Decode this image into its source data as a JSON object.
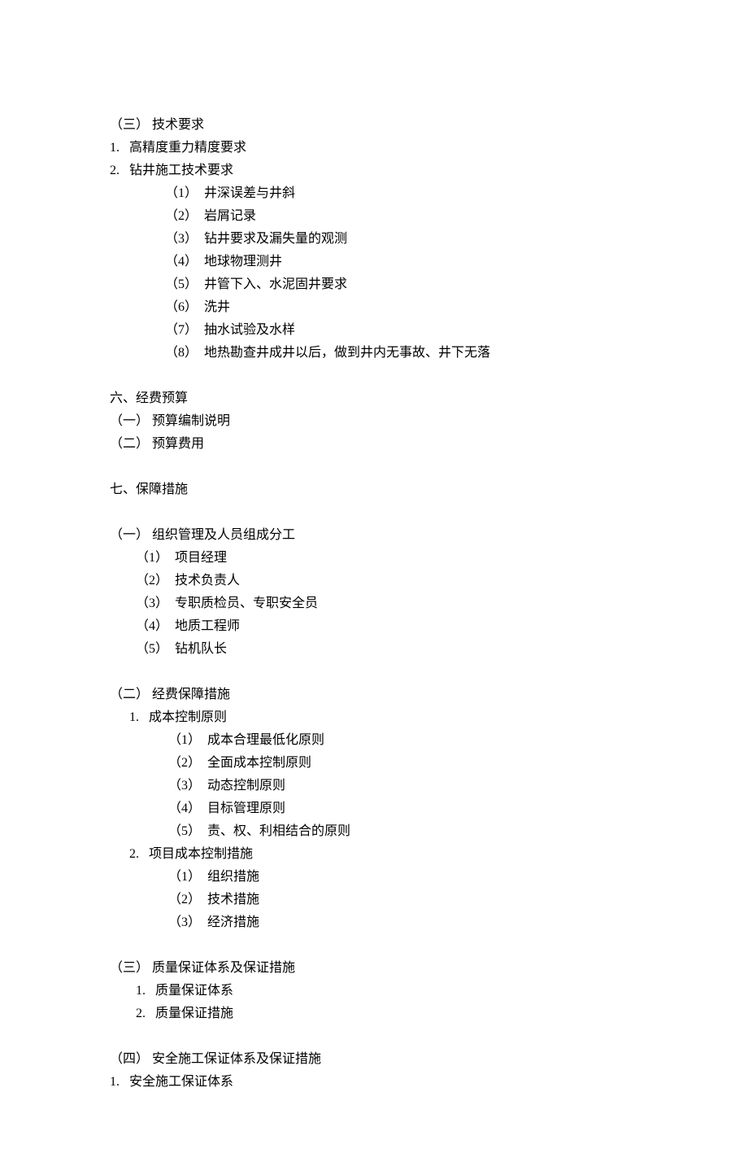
{
  "section3": {
    "title": "（三） 技术要求",
    "item1": "1.   高精度重力精度要求",
    "item2": "2.   钻井施工技术要求",
    "sub": [
      "（1）  井深误差与井斜",
      "（2）  岩屑记录",
      "（3）  钻井要求及漏失量的观测",
      "（4）  地球物理测井",
      "（5）  井管下入、水泥固井要求",
      "（6）  洗井",
      "（7）  抽水试验及水样",
      "（8）  地热勘查井成井以后，做到井内无事故、井下无落"
    ]
  },
  "section6": {
    "title": "六、经费预算",
    "items": [
      "（一） 预算编制说明",
      "（二） 预算费用"
    ]
  },
  "section7": {
    "title": "七、保障措施",
    "sub1": {
      "title": "（一） 组织管理及人员组成分工",
      "items": [
        "（1）  项目经理",
        "（2）  技术负责人",
        "（3）  专职质检员、专职安全员",
        "（4）  地质工程师",
        "（5）  钻机队长"
      ]
    },
    "sub2": {
      "title": "（二） 经费保障措施",
      "item1": "1.   成本控制原则",
      "item1sub": [
        "（1）  成本合理最低化原则",
        "（2）  全面成本控制原则",
        "（3）  动态控制原则",
        "（4）  目标管理原则",
        "（5）  责、权、利相结合的原则"
      ],
      "item2": "2.   项目成本控制措施",
      "item2sub": [
        "（1）  组织措施",
        "（2）  技术措施",
        "（3）  经济措施"
      ]
    },
    "sub3": {
      "title": "（三） 质量保证体系及保证措施",
      "items": [
        "1.   质量保证体系",
        "2.   质量保证措施"
      ]
    },
    "sub4": {
      "title": "（四） 安全施工保证体系及保证措施",
      "item1": "1.   安全施工保证体系"
    }
  }
}
